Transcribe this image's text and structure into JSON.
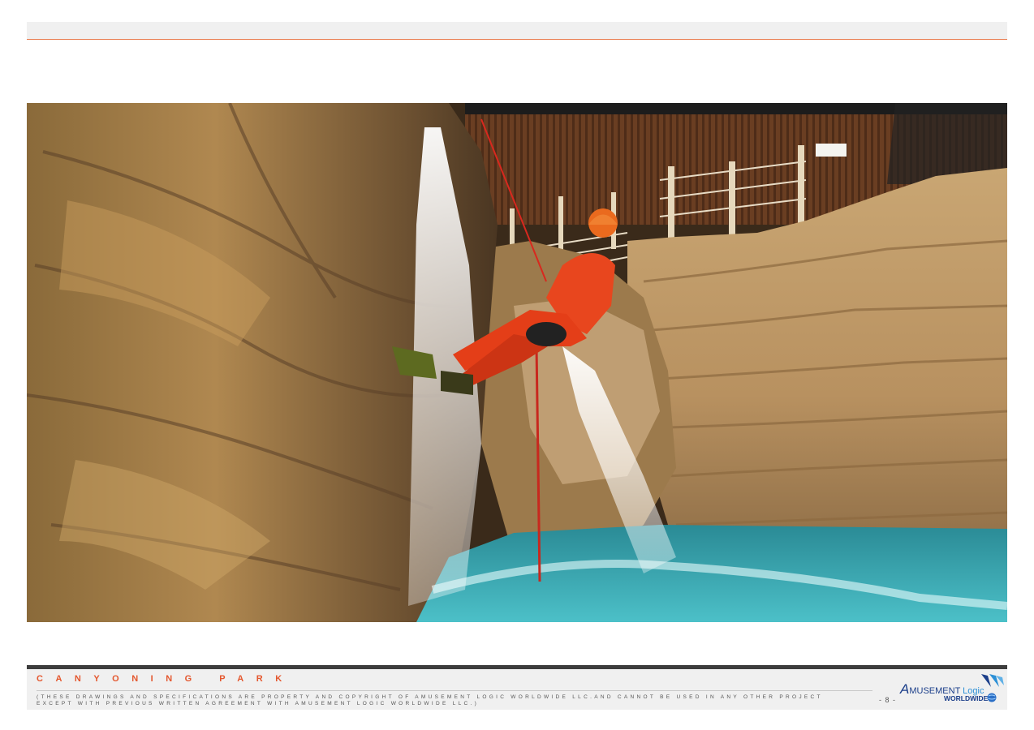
{
  "footer": {
    "title": "CANYONING PARK",
    "disclaimer_line1": "(THESE DRAWINGS AND SPECIFICATIONS ARE PROPERTY AND COPYRIGHT OF AMUSEMENT LOGIC WORLDWIDE LLC.AND CANNOT BE USED IN ANY OTHER PROJECT",
    "disclaimer_line2": "EXCEPT WITH PREVIOUS WRITTEN AGREEMENT WITH AMUSEMENT LOGIC WORLDWIDE LLC.)",
    "page_number": "- 8 -"
  },
  "logo": {
    "initial": "A",
    "word1": "MUSEMENT",
    "word2": "Logic",
    "line2": "WORLDWIDE"
  },
  "colors": {
    "accent": "#e4572e",
    "footer_bar": "#3d3d3d",
    "band": "#f0f0f0",
    "logo_blue": "#1c3f8a"
  }
}
